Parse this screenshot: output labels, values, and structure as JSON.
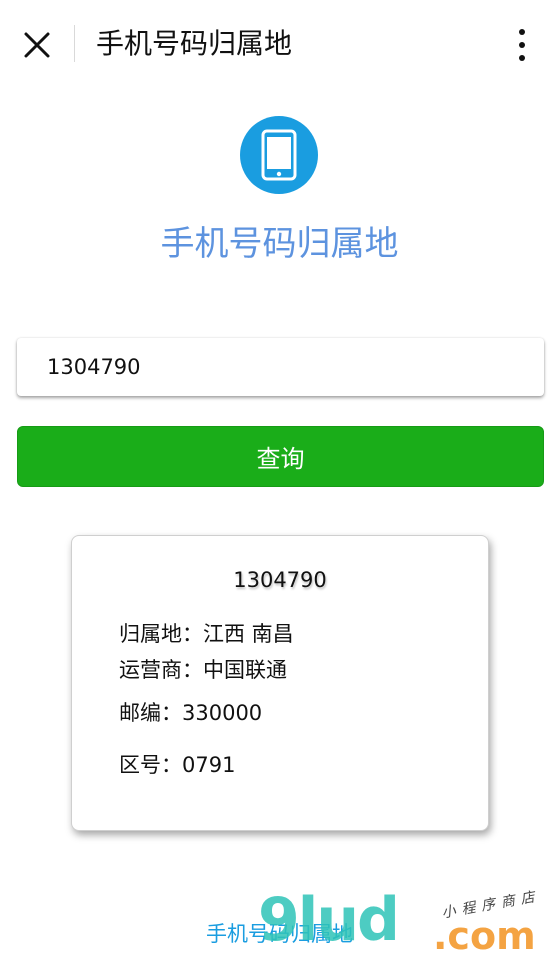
{
  "header": {
    "title": "手机号码归属地",
    "close_icon": "close-icon",
    "more_icon": "more-vertical-icon"
  },
  "app": {
    "icon": "mobile-phone-icon",
    "icon_color": "#1a9de0",
    "heading": "手机号码归属地",
    "heading_color": "#5d93df"
  },
  "search": {
    "value": "1304790"
  },
  "query_button": {
    "label": "查询",
    "color": "#1aad19"
  },
  "result": {
    "number": "1304790",
    "location": "归属地：江西 南昌",
    "carrier": "运营商：中国联通",
    "postcode": "邮编：330000",
    "area_code": "区号：0791"
  },
  "footer": {
    "link": "手机号码归属地",
    "link_color": "#1a9de0"
  },
  "watermark": {
    "brand": "9lud",
    "domain": ".com",
    "tagline": "小程序商店"
  }
}
